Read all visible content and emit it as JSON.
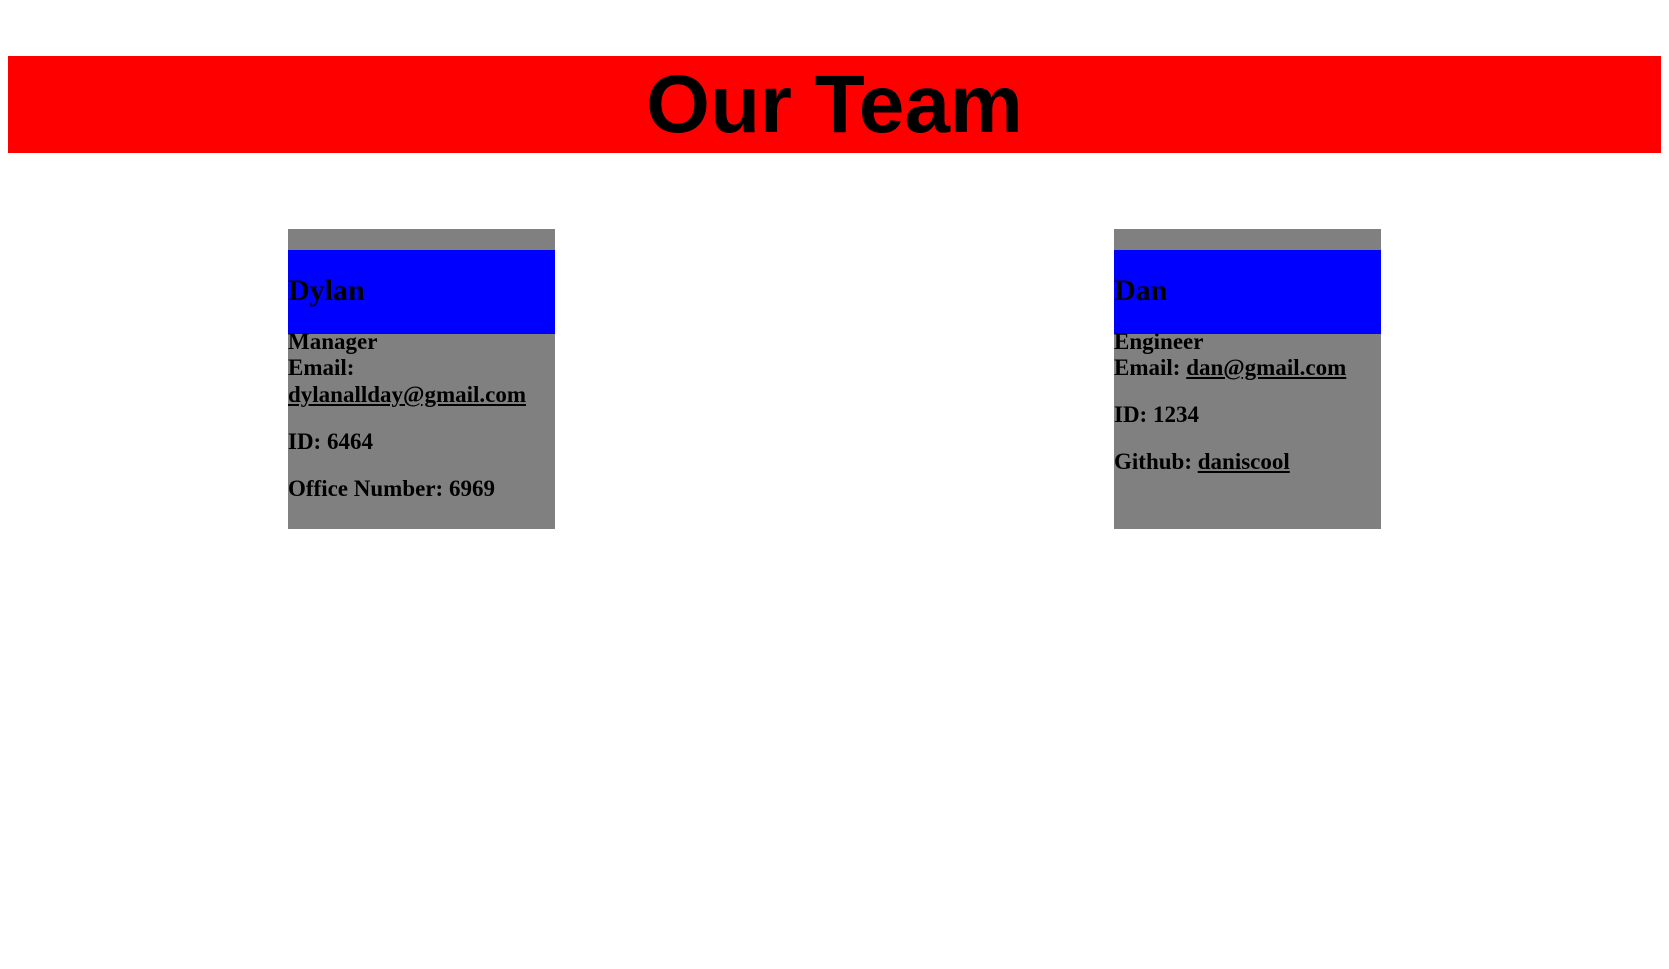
{
  "header": {
    "title": "Our Team"
  },
  "team": [
    {
      "name": "Dylan",
      "role": "Manager",
      "email_label": "Email:",
      "email": "dylanallday@gmail.com",
      "id_label": "ID:",
      "id": "6464",
      "extra_label": "Office Number:",
      "extra_value": "6969"
    },
    {
      "name": "Dan",
      "role": "Engineer",
      "email_label": "Email:",
      "email": "dan@gmail.com",
      "id_label": "ID:",
      "id": "1234",
      "extra_label": "Github:",
      "extra_value": "daniscool"
    }
  ],
  "colors": {
    "header_bg": "#ff0000",
    "card_bg": "#808080",
    "card_head_bg": "#0000ff"
  }
}
